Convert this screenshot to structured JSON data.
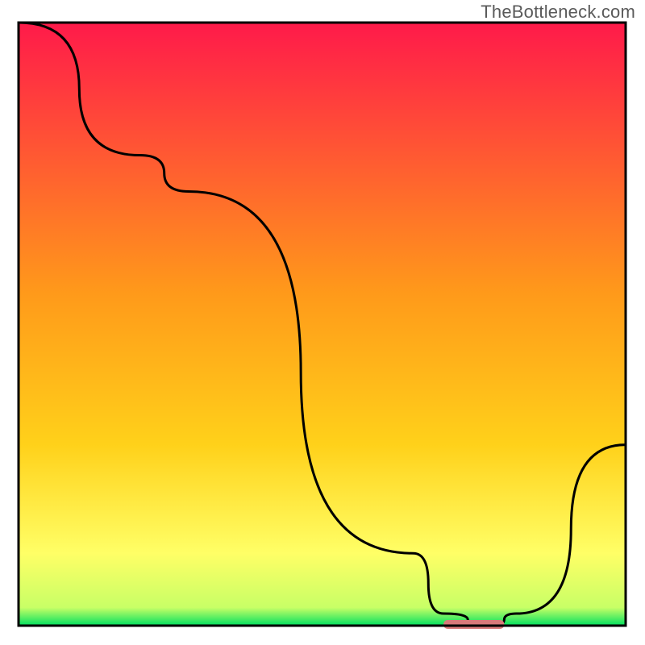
{
  "watermark": "TheBottleneck.com",
  "chart_data": {
    "type": "line",
    "title": "",
    "xlabel": "",
    "ylabel": "",
    "xlim": [
      0,
      100
    ],
    "ylim": [
      0,
      100
    ],
    "x": [
      0,
      20,
      28,
      65,
      70,
      78,
      82,
      100
    ],
    "values": [
      100,
      78,
      72,
      12,
      2,
      0,
      2,
      30
    ],
    "marker_segment": {
      "x0": 70,
      "x1": 80,
      "y": 0
    },
    "colors": {
      "gradient_top": "#ff1a4a",
      "gradient_mid": "#ffd11a",
      "gradient_low": "#ffff66",
      "gradient_bottom": "#00e060",
      "line": "#000000",
      "border": "#000000",
      "marker": "#d97a7a"
    }
  }
}
